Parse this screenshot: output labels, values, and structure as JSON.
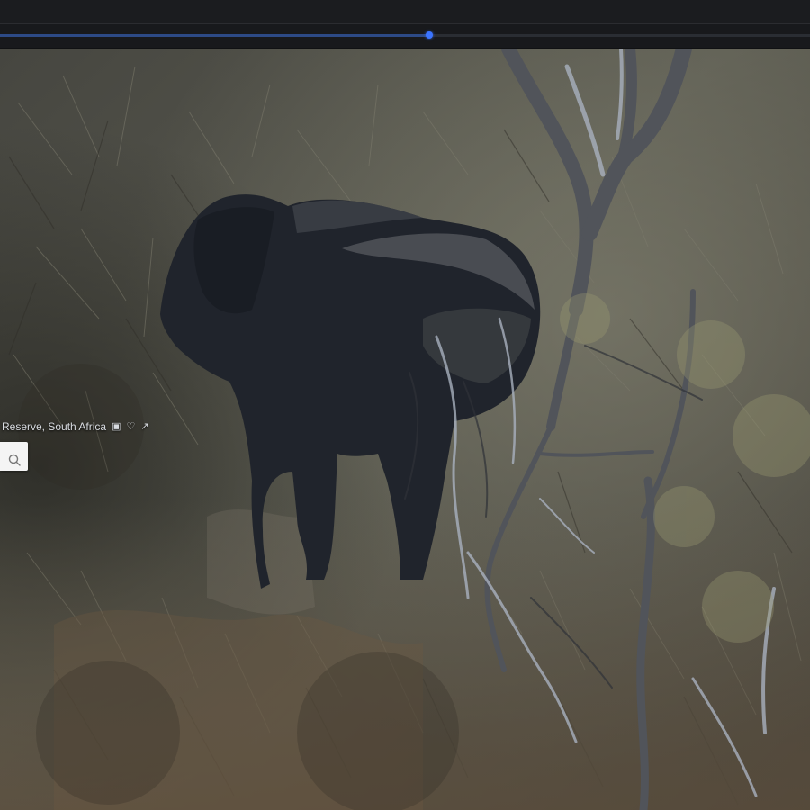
{
  "player": {
    "playback_progress": 0.53,
    "accent_color": "#3b74ff"
  },
  "overlay": {
    "location_text": "Reserve, South Africa",
    "icons": [
      "screen-icon",
      "heart-icon",
      "share-icon"
    ]
  },
  "search": {
    "icon": "search-icon"
  },
  "colors": {
    "top_bar": "#1b1c1f",
    "scrubber_thumb": "#3b74ff",
    "caption_text": "#d8dbe0"
  }
}
